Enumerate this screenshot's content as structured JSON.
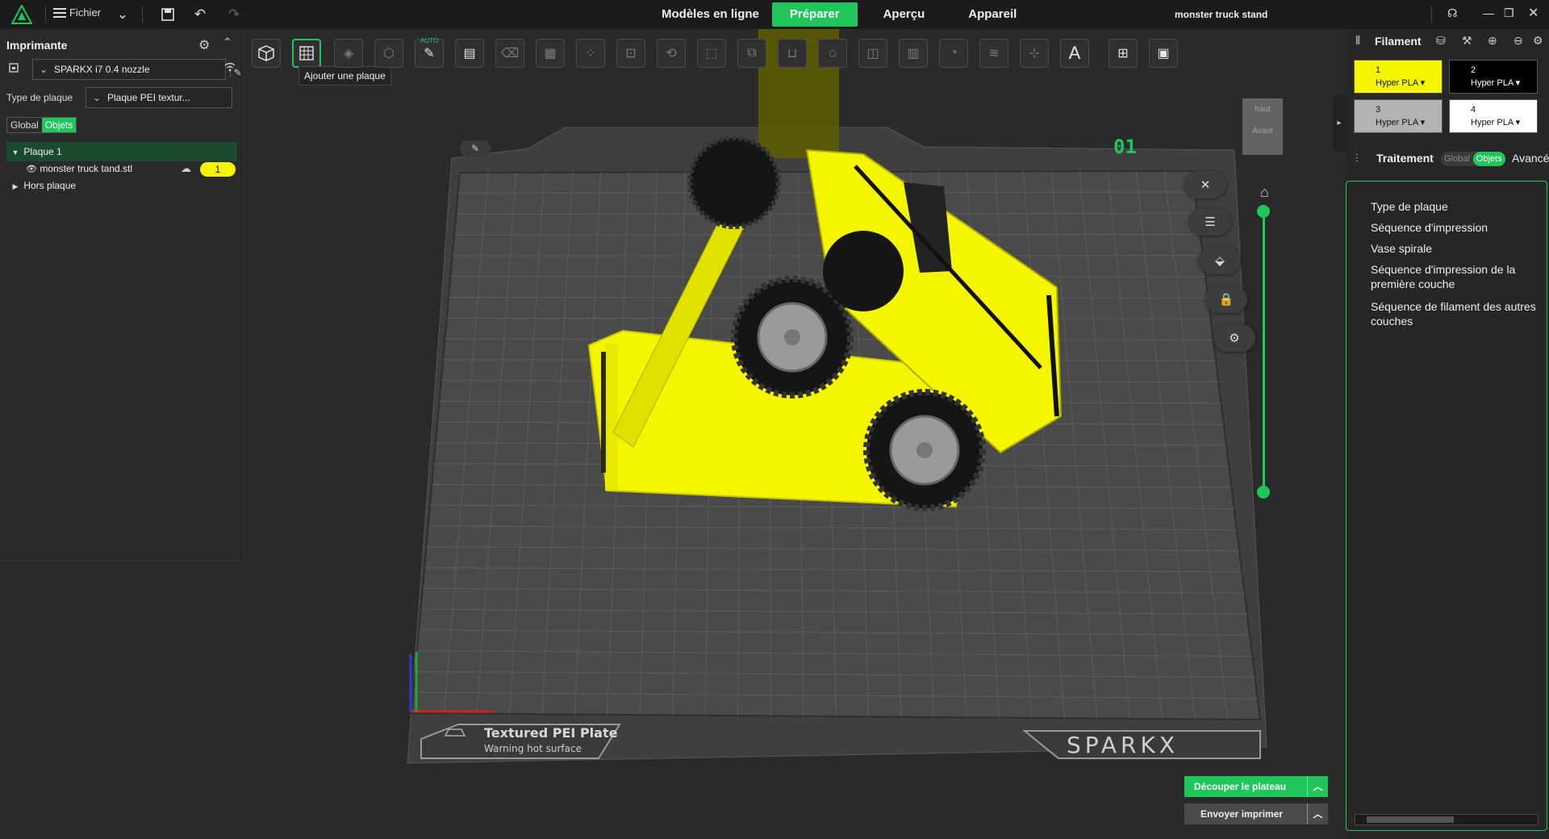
{
  "topbar": {
    "menu_label": "Fichier",
    "tabs": [
      {
        "label": "Modèles en ligne"
      },
      {
        "label": "Préparer"
      },
      {
        "label": "Aperçu"
      },
      {
        "label": "Appareil"
      }
    ],
    "doc_title": "monster truck stand"
  },
  "left_panel": {
    "title": "Imprimante",
    "printer": "SPARKX i7 0.4 nozzle",
    "plate_type_label": "Type de plaque",
    "plate_type_value": "Plaque PEI textur...",
    "tabs": [
      "Global",
      "Objets"
    ],
    "tree": {
      "plate": "Plaque 1",
      "object": "monster truck tand.stl",
      "object_badge": "1",
      "outside": "Hors plaque"
    }
  },
  "viewport": {
    "tooltip": "Ajouter une plaque",
    "plate_number": "01",
    "viewcube_top": "haut",
    "viewcube_front": "Avant",
    "auto_label": "AUTO",
    "bed_label_1": "Textured PEI Plate",
    "bed_label_2": "Warning hot surface",
    "bed_brand": "SPARKX"
  },
  "right_panel": {
    "filament_title": "Filament",
    "filaments": [
      {
        "num": "1",
        "name": "Hyper PLA",
        "color": "#f5f500",
        "text": "#111111"
      },
      {
        "num": "2",
        "name": "Hyper PLA",
        "color": "#000000",
        "text": "#ffffff"
      },
      {
        "num": "3",
        "name": "Hyper PLA",
        "color": "#b3b3b3",
        "text": "#111111"
      },
      {
        "num": "4",
        "name": "Hyper PLA",
        "color": "#ffffff",
        "text": "#111111"
      }
    ],
    "traitement_title": "Traitement",
    "traitement_tabs": [
      "Global",
      "Objets"
    ],
    "traitement_advanced": "Avancé",
    "items": [
      "Type de plaque",
      "Séquence d'impression",
      "Vase spirale",
      "Séquence d'impression de la première couche",
      "Séquence de filament des autres couches"
    ]
  },
  "actions": {
    "slice": "Découper le plateau",
    "print": "Envoyer imprimer"
  },
  "colors": {
    "accent": "#1fc75a",
    "model": "#f5f500",
    "background": "#2a2a2b"
  }
}
